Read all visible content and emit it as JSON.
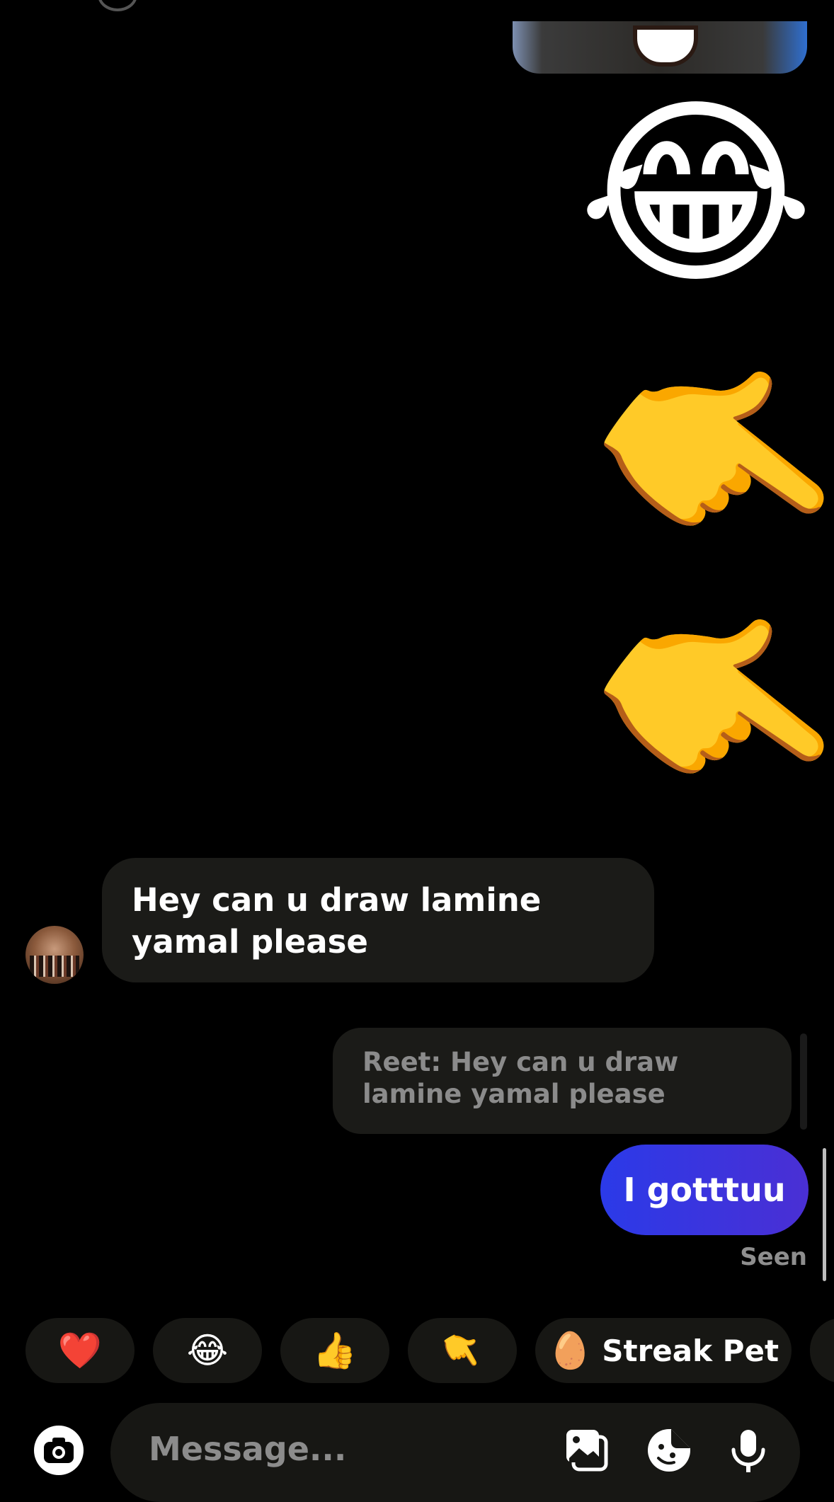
{
  "messages": {
    "big_emojis": [
      "😂",
      "👉",
      "👉"
    ],
    "received": {
      "text": "Hey can u draw lamine yamal please"
    },
    "reply_quote": {
      "text": "Reet: Hey can u draw lamine yamal please"
    },
    "sent": {
      "text": "I gotttuu"
    },
    "status": "Seen"
  },
  "quick_reactions": [
    {
      "emoji": "❤️"
    },
    {
      "emoji": "😂"
    },
    {
      "emoji": "👍"
    },
    {
      "emoji": "👆"
    },
    {
      "emoji": "🥚",
      "label": "Streak Pet"
    }
  ],
  "composer": {
    "placeholder": "Message..."
  },
  "icons": {
    "camera": "camera-icon",
    "gallery": "gallery-icon",
    "sticker": "sticker-icon",
    "microphone": "microphone-icon"
  }
}
